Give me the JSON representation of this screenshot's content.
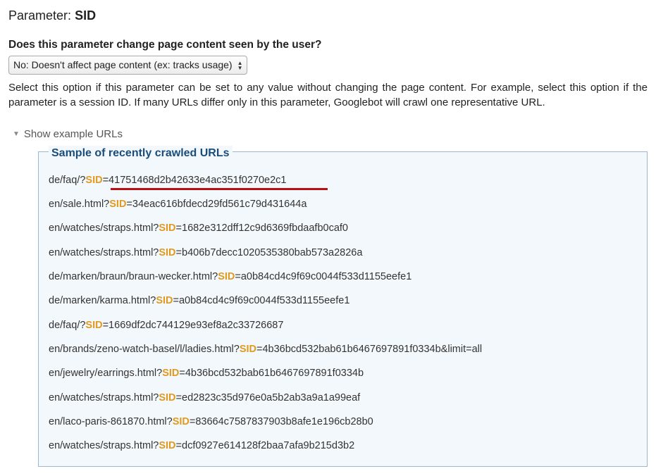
{
  "header": {
    "label": "Parameter:",
    "param_name": "SID"
  },
  "question": "Does this parameter change page content seen by the user?",
  "select": {
    "value": "No: Doesn't affect page content (ex: tracks usage)"
  },
  "description": "Select this option if this parameter can be set to any value without changing the page content. For example, select this option if the parameter is a session ID. If many URLs differ only in this parameter, Googlebot will crawl one representative URL.",
  "toggle_label": "Show example URLs",
  "sample_title": "Sample of recently crawled URLs",
  "sid_key": "SID",
  "urls": [
    {
      "pre": "de/faq/?",
      "suf": "=41751468d2b42633e4ac351f0270e2c1",
      "highlight": true
    },
    {
      "pre": "en/sale.html?",
      "suf": "=34eac616bfdecd29fd561c79d431644a"
    },
    {
      "pre": "en/watches/straps.html?",
      "suf": "=1682e312dff12c9d6369fbdaafb0caf0"
    },
    {
      "pre": "en/watches/straps.html?",
      "suf": "=b406b7decc1020535380bab573a2826a"
    },
    {
      "pre": "de/marken/braun/braun-wecker.html?",
      "suf": "=a0b84cd4c9f69c0044f533d1155eefe1"
    },
    {
      "pre": "de/marken/karma.html?",
      "suf": "=a0b84cd4c9f69c0044f533d1155eefe1"
    },
    {
      "pre": "de/faq/?",
      "suf": "=1669df2dc744129e93ef8a2c33726687"
    },
    {
      "pre": "en/brands/zeno-watch-basel/l/ladies.html?",
      "suf": "=4b36bcd532bab61b6467697891f0334b&limit=all"
    },
    {
      "pre": "en/jewelry/earrings.html?",
      "suf": "=4b36bcd532bab61b6467697891f0334b"
    },
    {
      "pre": "en/watches/straps.html?",
      "suf": "=ed2823c35d976e0a5b2ab3a9a1a99eaf"
    },
    {
      "pre": "en/laco-paris-861870.html?",
      "suf": "=83664c7587837903b8afe1e196cb28b0"
    },
    {
      "pre": "en/watches/straps.html?",
      "suf": "=dcf0927e614128f2baa7afa9b215d3b2"
    }
  ]
}
